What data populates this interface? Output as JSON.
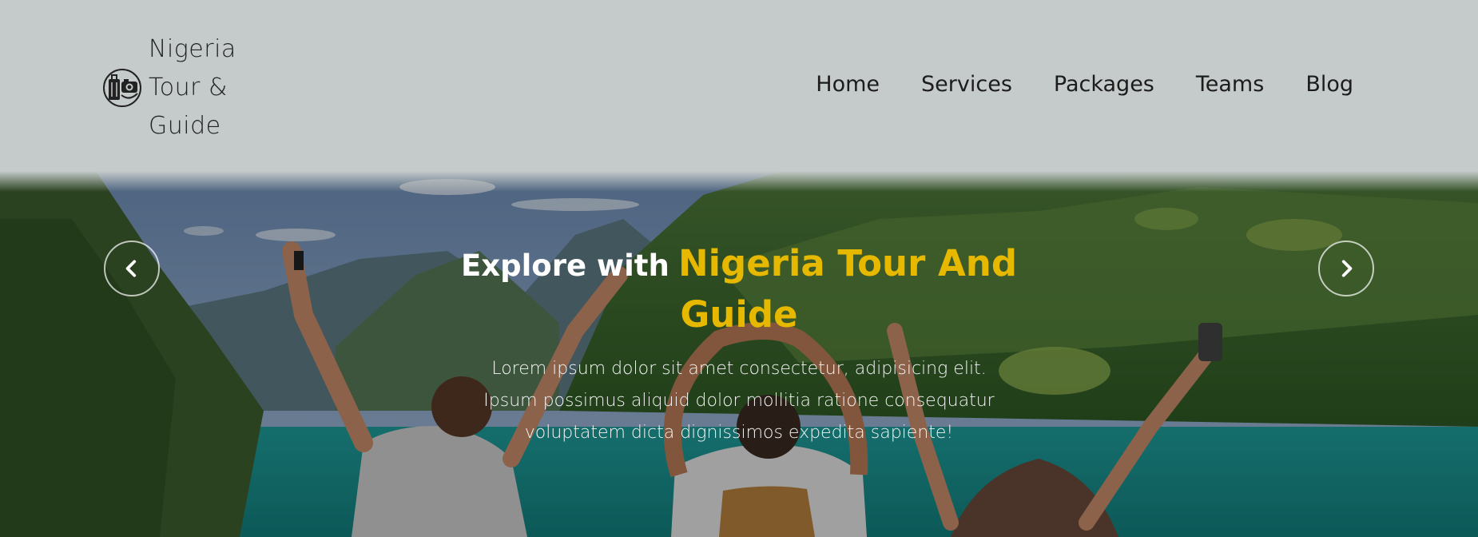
{
  "logo": {
    "line1": "Nigeria",
    "line2": "Tour &",
    "line3": "Guide",
    "icon": "luggage-camera-icon"
  },
  "nav": {
    "items": [
      {
        "label": "Home"
      },
      {
        "label": "Services"
      },
      {
        "label": "Packages"
      },
      {
        "label": "Teams"
      },
      {
        "label": "Blog"
      }
    ]
  },
  "hero": {
    "title_prefix": "Explore with",
    "title_brand": "Nigeria Tour And Guide",
    "description": "Lorem ipsum dolor sit amet consectetur, adipisicing elit. Ipsum possimus aliquid dolor mollitia ratione consequatur voluptatem dicta dignissimos expedita sapiente!",
    "prev_icon": "chevron-left-icon",
    "next_icon": "chevron-right-icon"
  },
  "colors": {
    "header_bg": "#c5cbca",
    "brand_accent": "#e6b800",
    "nav_text": "#1c1c1c"
  }
}
